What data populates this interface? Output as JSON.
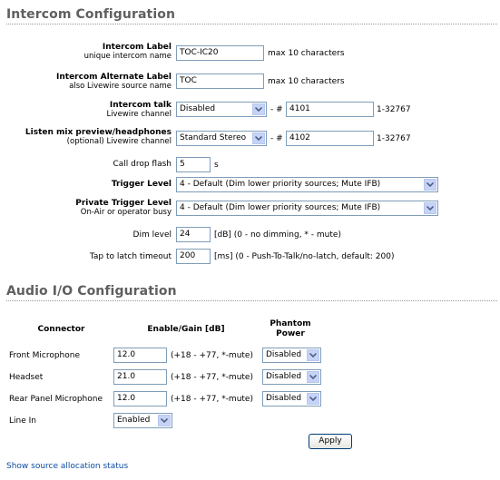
{
  "intercom": {
    "title": "Intercom Configuration",
    "label": {
      "main": "Intercom Label",
      "sub": "unique intercom name",
      "value": "TOC-IC20",
      "hint": "max 10 characters"
    },
    "alt_label": {
      "main": "Intercom Alternate Label",
      "sub": "also Livewire source name",
      "value": "TOC",
      "hint": "max 10 characters"
    },
    "talk": {
      "main": "Intercom talk",
      "sub": "Livewire channel",
      "mode": "Disabled",
      "sep": "- #",
      "channel": "4101",
      "range": "1-32767"
    },
    "listen": {
      "main": "Listen mix preview/headphones",
      "sub": "(optional) Livewire channel",
      "mode": "Standard Stereo",
      "sep": "- #",
      "channel": "4102",
      "range": "1-32767"
    },
    "call_drop": {
      "label": "Call drop flash",
      "value": "5",
      "unit": "s"
    },
    "trigger": {
      "label": "Trigger Level",
      "value": "4 - Default (Dim lower priority sources; Mute IFB)"
    },
    "private_trigger": {
      "main": "Private Trigger Level",
      "sub": "On-Air or operator busy",
      "value": "4 - Default (Dim lower priority sources; Mute IFB)"
    },
    "dim": {
      "label": "Dim level",
      "value": "24",
      "hint": "[dB] (0 - no dimming, * - mute)"
    },
    "tap": {
      "label": "Tap to latch timeout",
      "value": "200",
      "hint": "[ms] (0 - Push-To-Talk/no-latch, default: 200)"
    }
  },
  "audio": {
    "title": "Audio I/O Configuration",
    "columns": {
      "connector": "Connector",
      "gain": "Enable/Gain [dB]",
      "phantom": "Phantom Power"
    },
    "rows": [
      {
        "name": "Front Microphone",
        "gain": "12.0",
        "hint": "(+18 - +77, *-mute)",
        "phantom": "Disabled"
      },
      {
        "name": "Headset",
        "gain": "21.0",
        "hint": "(+18 - +77, *-mute)",
        "phantom": "Disabled"
      },
      {
        "name": "Rear Panel Microphone",
        "gain": "12.0",
        "hint": "(+18 - +77, *-mute)",
        "phantom": "Disabled"
      },
      {
        "name": "Line In",
        "enable": "Enabled"
      }
    ],
    "apply_label": "Apply"
  },
  "footer": {
    "link": "Show source allocation status"
  },
  "icons": {
    "dropdown": "chevron-down-icon"
  },
  "colors": {
    "title": "#5f5f5f",
    "link": "#0b4ea2",
    "field_border": "#7f9db9",
    "dropdown_button": "#c6d3f7"
  }
}
